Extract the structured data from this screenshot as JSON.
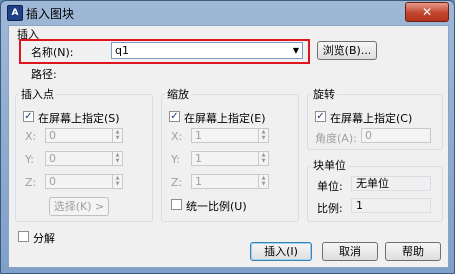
{
  "window": {
    "title": "插入图块",
    "app_icon": "A",
    "close_glyph": "✕"
  },
  "insert": {
    "group_title": "插入",
    "name_label": "名称(N):",
    "name_value": "q1",
    "browse_button": "浏览(B)...",
    "path_label": "路径:"
  },
  "insertion_point": {
    "group_title": "插入点",
    "specify_on_screen": "在屏幕上指定(S)",
    "specify_checked": true,
    "x_label": "X:",
    "x_value": "0",
    "y_label": "Y:",
    "y_value": "0",
    "z_label": "Z:",
    "z_value": "0",
    "select_button": "选择(K) >"
  },
  "scale": {
    "group_title": "缩放",
    "specify_on_screen": "在屏幕上指定(E)",
    "specify_checked": true,
    "x_label": "X:",
    "x_value": "1",
    "y_label": "Y:",
    "y_value": "1",
    "z_label": "Z:",
    "z_value": "1",
    "uniform_scale": "统一比例(U)",
    "uniform_checked": false
  },
  "rotation": {
    "group_title": "旋转",
    "specify_on_screen": "在屏幕上指定(C)",
    "specify_checked": true,
    "angle_label": "角度(A):",
    "angle_value": "0"
  },
  "block_unit": {
    "group_title": "块单位",
    "unit_label": "单位:",
    "unit_value": "无单位",
    "factor_label": "比例:",
    "factor_value": "1"
  },
  "explode": {
    "label": "分解",
    "checked": false
  },
  "buttons": {
    "insert": "插入(I)",
    "cancel": "取消",
    "help": "帮助"
  },
  "icons": {
    "check": "✓",
    "dropdown": "▼",
    "spin_up": "▲",
    "spin_down": "▼"
  }
}
